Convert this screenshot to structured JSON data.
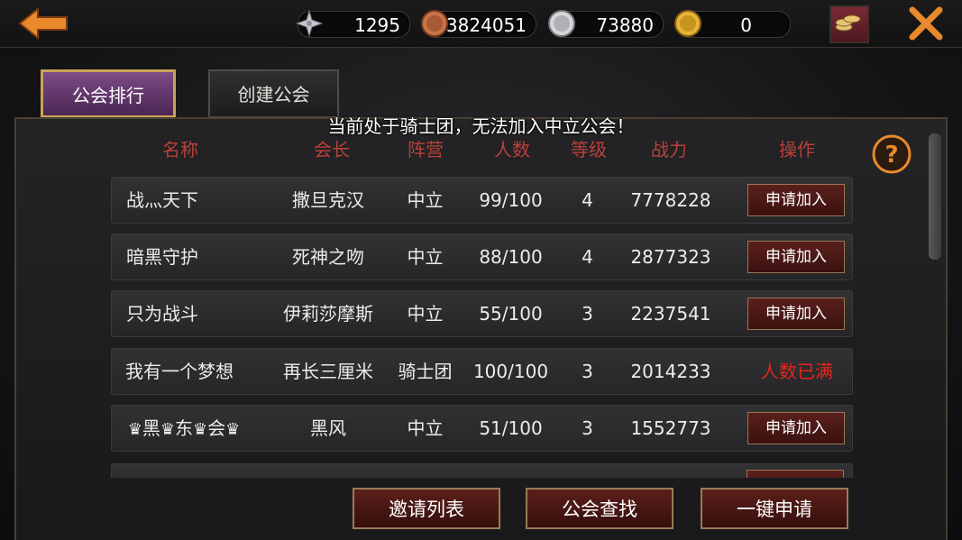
{
  "resources": [
    {
      "icon": "cross-emblem-icon",
      "value": "1295"
    },
    {
      "icon": "copper-coin-icon",
      "value": "3824051"
    },
    {
      "icon": "silver-coin-icon",
      "value": "73880"
    },
    {
      "icon": "gold-coin-icon",
      "value": "0"
    }
  ],
  "tabs": {
    "rank": "公会排行",
    "create": "创建公会"
  },
  "notice": "当前处于骑士团，无法加入中立公会！",
  "headers": {
    "name": "名称",
    "leader": "会长",
    "camp": "阵营",
    "count": "人数",
    "level": "等级",
    "power": "战力",
    "action": "操作"
  },
  "rows": [
    {
      "name": "战灬天下",
      "leader": "撒旦克汉",
      "camp": "中立",
      "count": "99/100",
      "level": "4",
      "power": "7778228",
      "action": "申请加入"
    },
    {
      "name": "暗黑守护",
      "leader": "死神之吻",
      "camp": "中立",
      "count": "88/100",
      "level": "4",
      "power": "2877323",
      "action": "申请加入"
    },
    {
      "name": "只为战斗",
      "leader": "伊莉莎摩斯",
      "camp": "中立",
      "count": "55/100",
      "level": "3",
      "power": "2237541",
      "action": "申请加入"
    },
    {
      "name": "我有一个梦想",
      "leader": "再长三厘米",
      "camp": "骑士团",
      "count": "100/100",
      "level": "3",
      "power": "2014233",
      "action": "人数已满"
    },
    {
      "name_parts": [
        "黑",
        "东",
        "会"
      ],
      "leader": "黑风",
      "camp": "中立",
      "count": "51/100",
      "level": "3",
      "power": "1552773",
      "action": "申请加入"
    }
  ],
  "buttons": {
    "invite": "邀请列表",
    "search": "公会查找",
    "quick_apply": "一键申请"
  },
  "colors": {
    "header": "#b9403a",
    "full": "#e3261d",
    "accent": "#c9a25a"
  }
}
